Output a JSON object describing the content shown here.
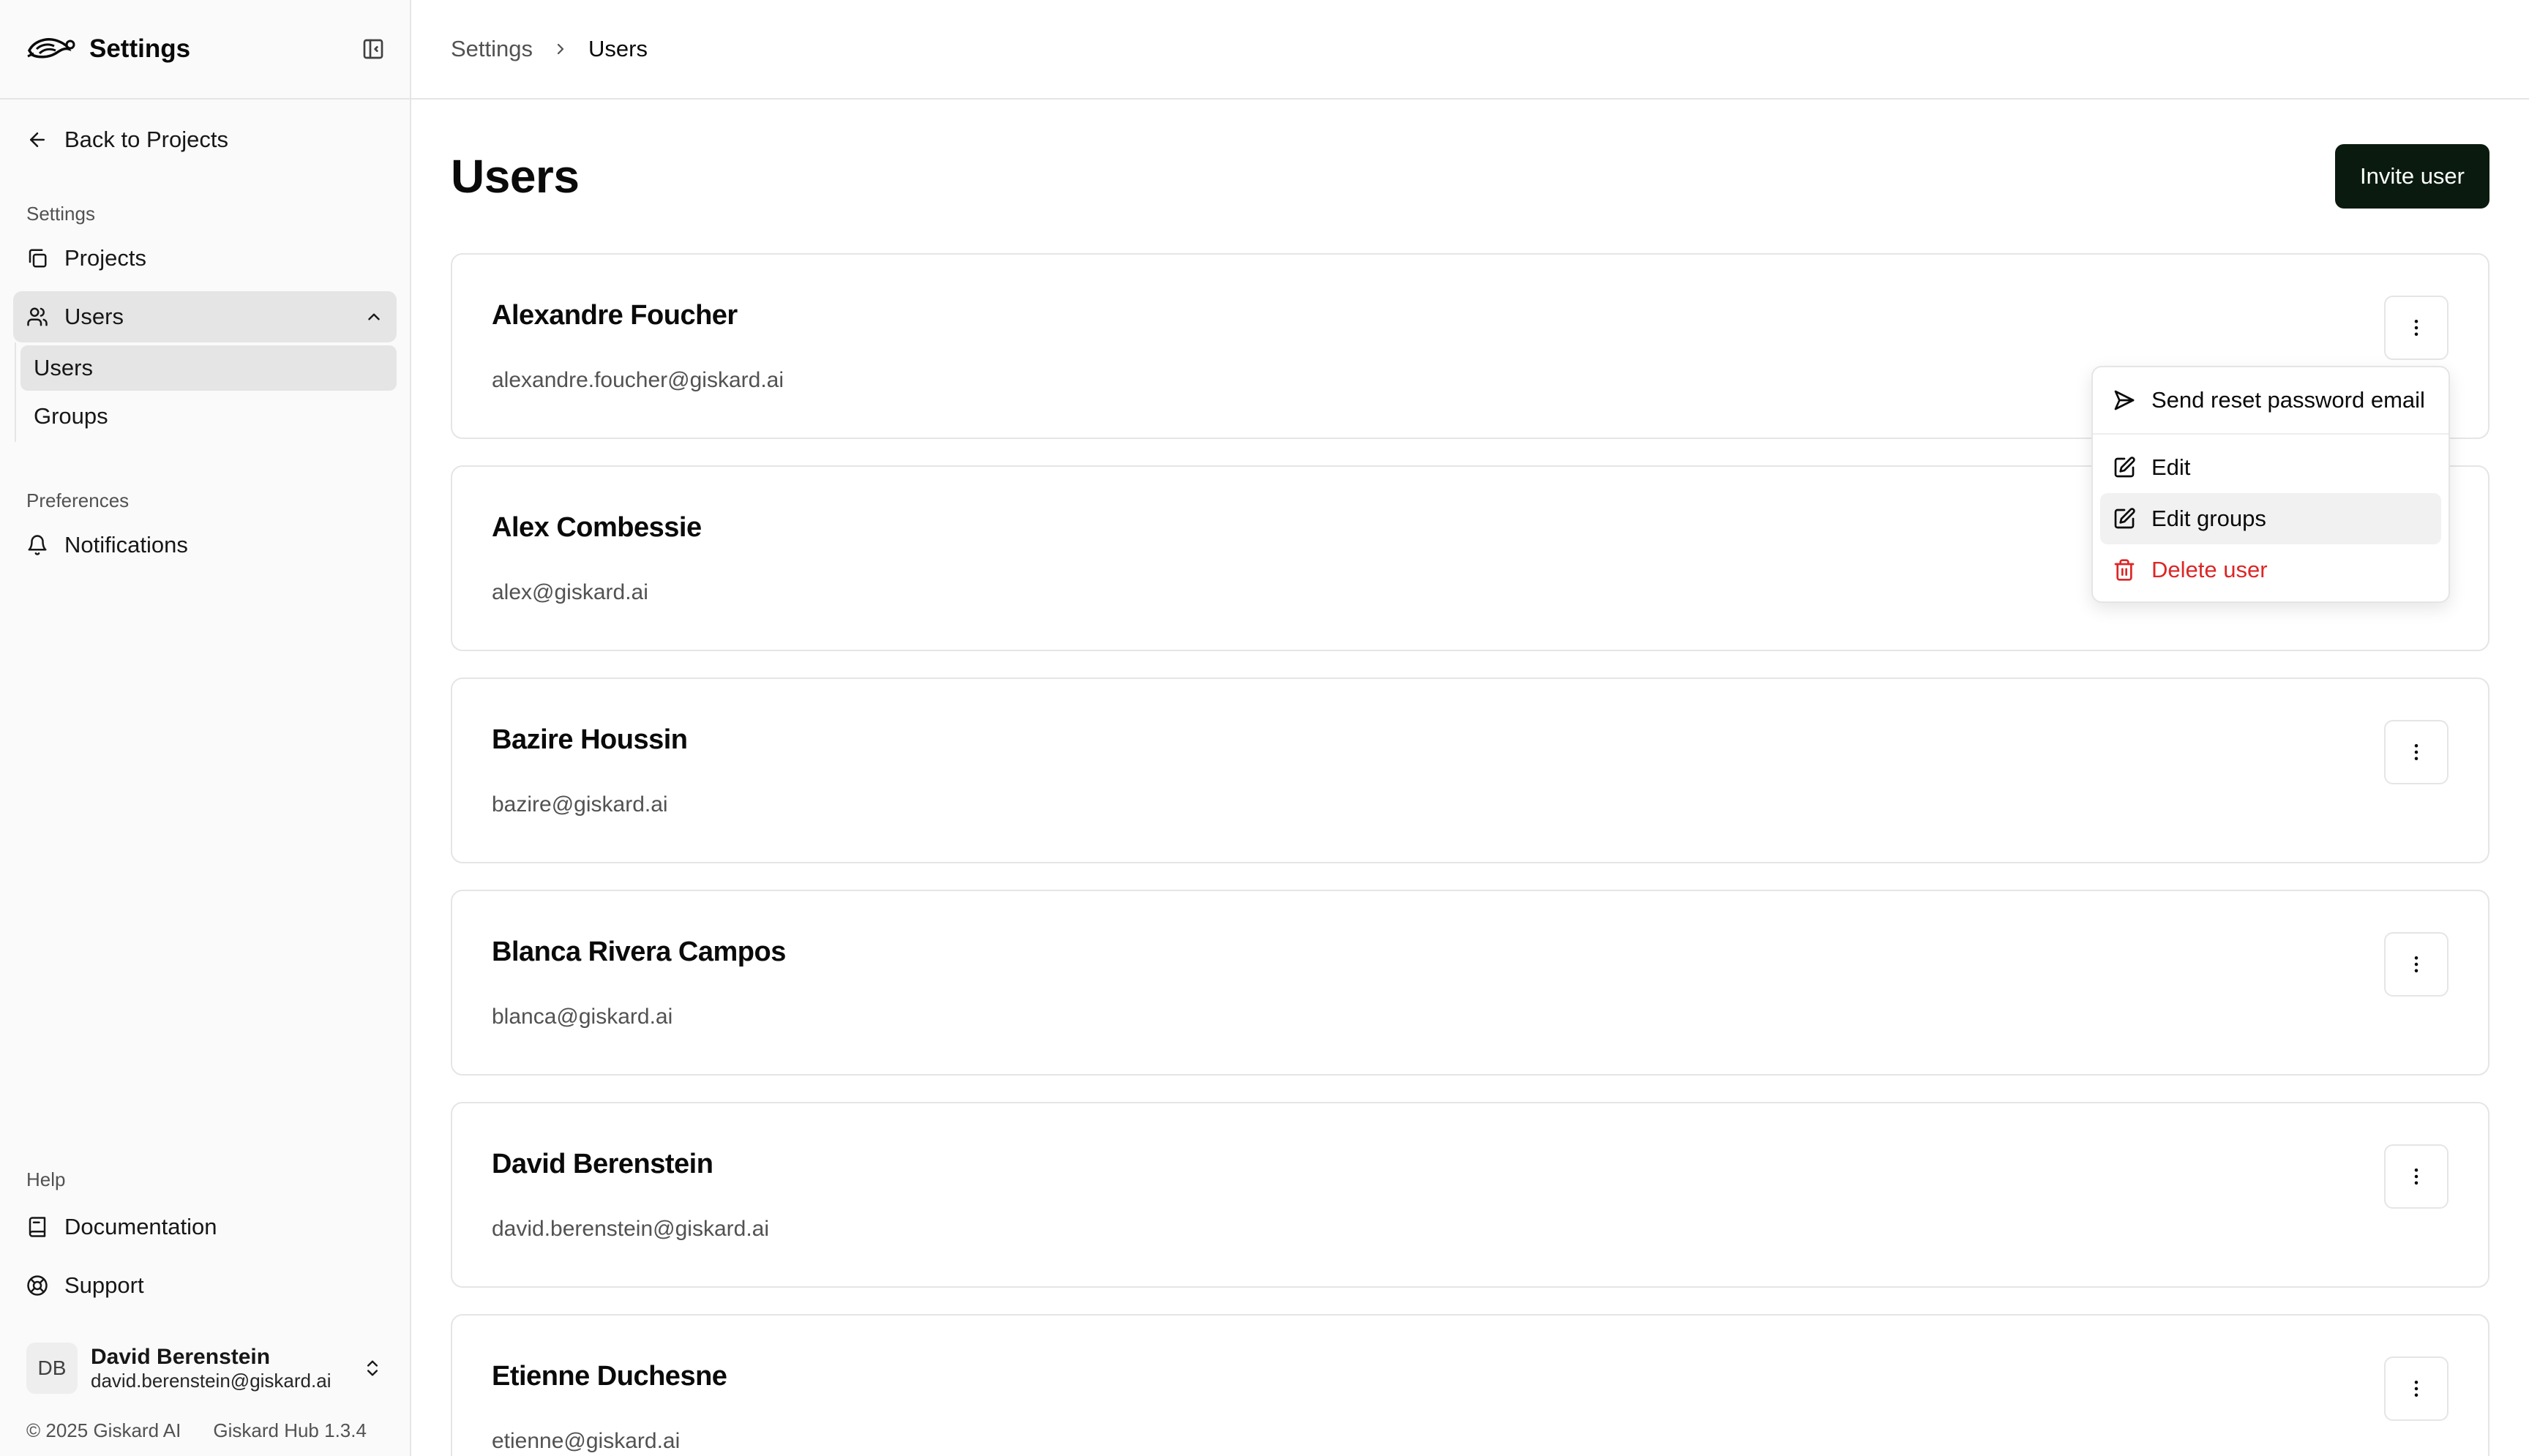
{
  "sidebar": {
    "title": "Settings",
    "back_label": "Back to Projects",
    "section_settings": "Settings",
    "projects_label": "Projects",
    "users_label": "Users",
    "sub_users_label": "Users",
    "sub_groups_label": "Groups",
    "section_preferences": "Preferences",
    "notifications_label": "Notifications",
    "section_help": "Help",
    "documentation_label": "Documentation",
    "support_label": "Support",
    "current_user": {
      "initials": "DB",
      "name": "David Berenstein",
      "email": "david.berenstein@giskard.ai"
    },
    "copyright": "© 2025 Giskard AI",
    "version": "Giskard Hub 1.3.4"
  },
  "breadcrumb": {
    "parent": "Settings",
    "current": "Users"
  },
  "page": {
    "title": "Users",
    "invite_label": "Invite user"
  },
  "users": [
    {
      "name": "Alexandre Foucher",
      "email": "alexandre.foucher@giskard.ai"
    },
    {
      "name": "Alex Combessie",
      "email": "alex@giskard.ai"
    },
    {
      "name": "Bazire Houssin",
      "email": "bazire@giskard.ai"
    },
    {
      "name": "Blanca Rivera Campos",
      "email": "blanca@giskard.ai"
    },
    {
      "name": "David Berenstein",
      "email": "david.berenstein@giskard.ai"
    },
    {
      "name": "Etienne Duchesne",
      "email": "etienne@giskard.ai"
    }
  ],
  "menu": {
    "send_reset": "Send reset password email",
    "edit": "Edit",
    "edit_groups": "Edit groups",
    "delete_user": "Delete user"
  },
  "colors": {
    "primary_button": "#0a1a0e",
    "danger": "#dc2626",
    "active_nav": "#e5e5e5"
  }
}
